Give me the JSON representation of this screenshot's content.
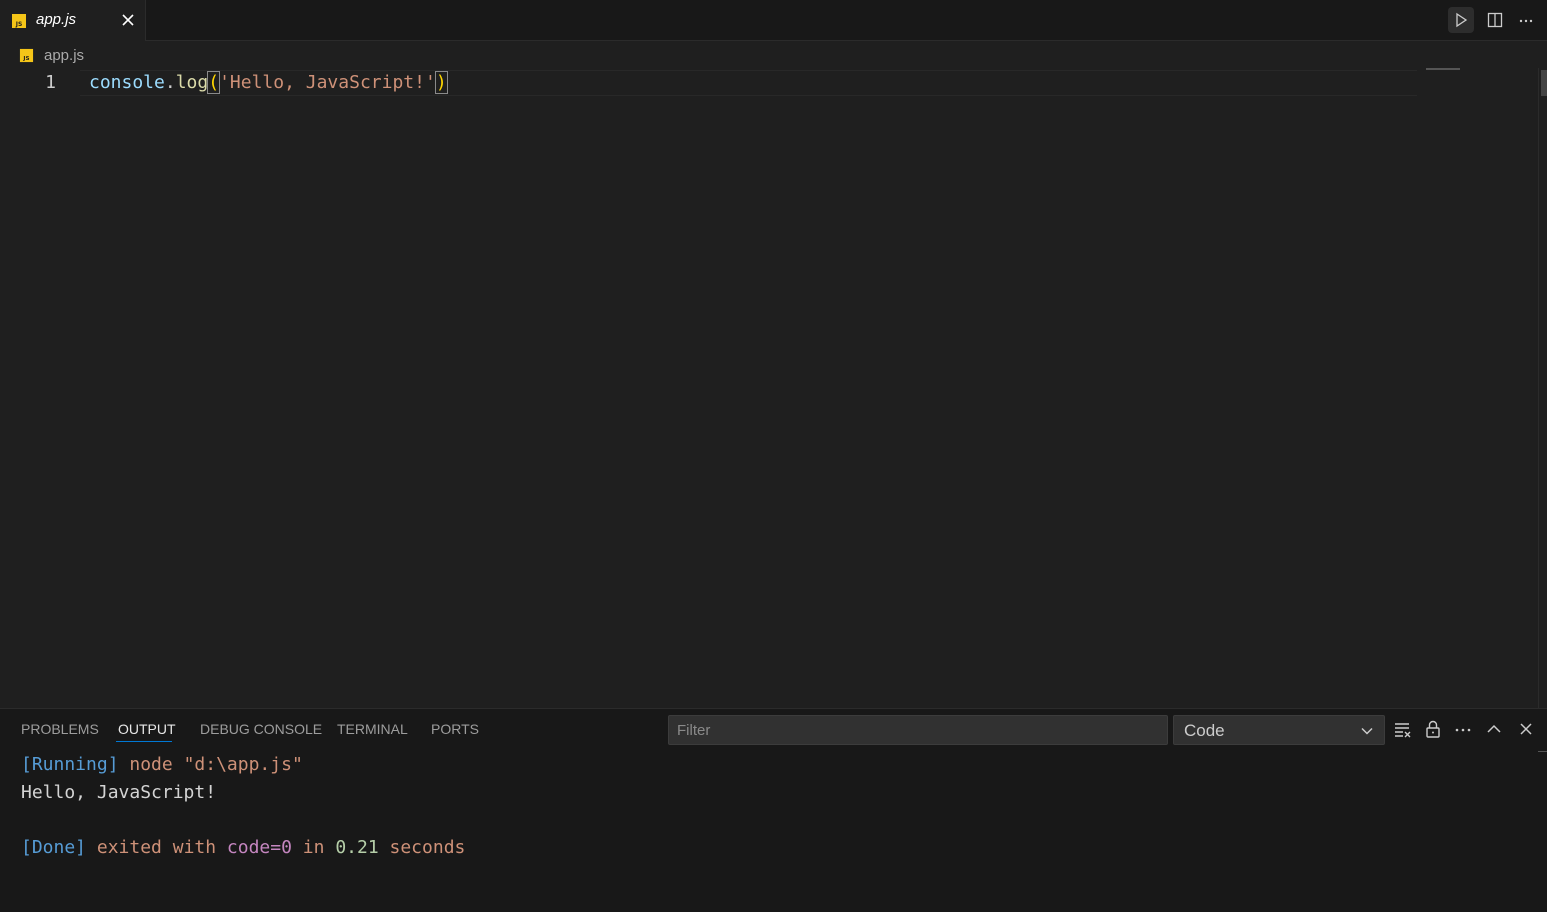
{
  "tabs": [
    {
      "label": "app.js",
      "icon": "js-file-icon",
      "active": true
    }
  ],
  "title_actions": [
    "run-icon",
    "split-editor-icon",
    "more-actions-icon"
  ],
  "breadcrumb": {
    "file": "app.js"
  },
  "editor": {
    "line_numbers": [
      "1"
    ],
    "code": {
      "obj": "console",
      "dot": ".",
      "fn": "log",
      "open": "(",
      "str": "'Hello, JavaScript!'",
      "close": ")"
    }
  },
  "panel": {
    "tabs": [
      "PROBLEMS",
      "OUTPUT",
      "DEBUG CONSOLE",
      "TERMINAL",
      "PORTS"
    ],
    "active_tab": "OUTPUT",
    "filter_placeholder": "Filter",
    "channel": "Code",
    "actions": [
      "clear-output-icon",
      "lock-icon",
      "more-icon",
      "maximize-icon",
      "close-icon"
    ],
    "output": {
      "running_tag": "[Running]",
      "running_cmd": " node \"d:\\app.js\"",
      "line2": "Hello, JavaScript!",
      "done_tag": "[Done]",
      "done_exited": " exited with ",
      "done_code": "code=0",
      "done_in": " in ",
      "done_time": "0.21",
      "done_seconds": " seconds"
    }
  },
  "colors": {
    "background": "#1f1f1f",
    "accent": "#0078d4",
    "js_icon": "#f5c518"
  }
}
